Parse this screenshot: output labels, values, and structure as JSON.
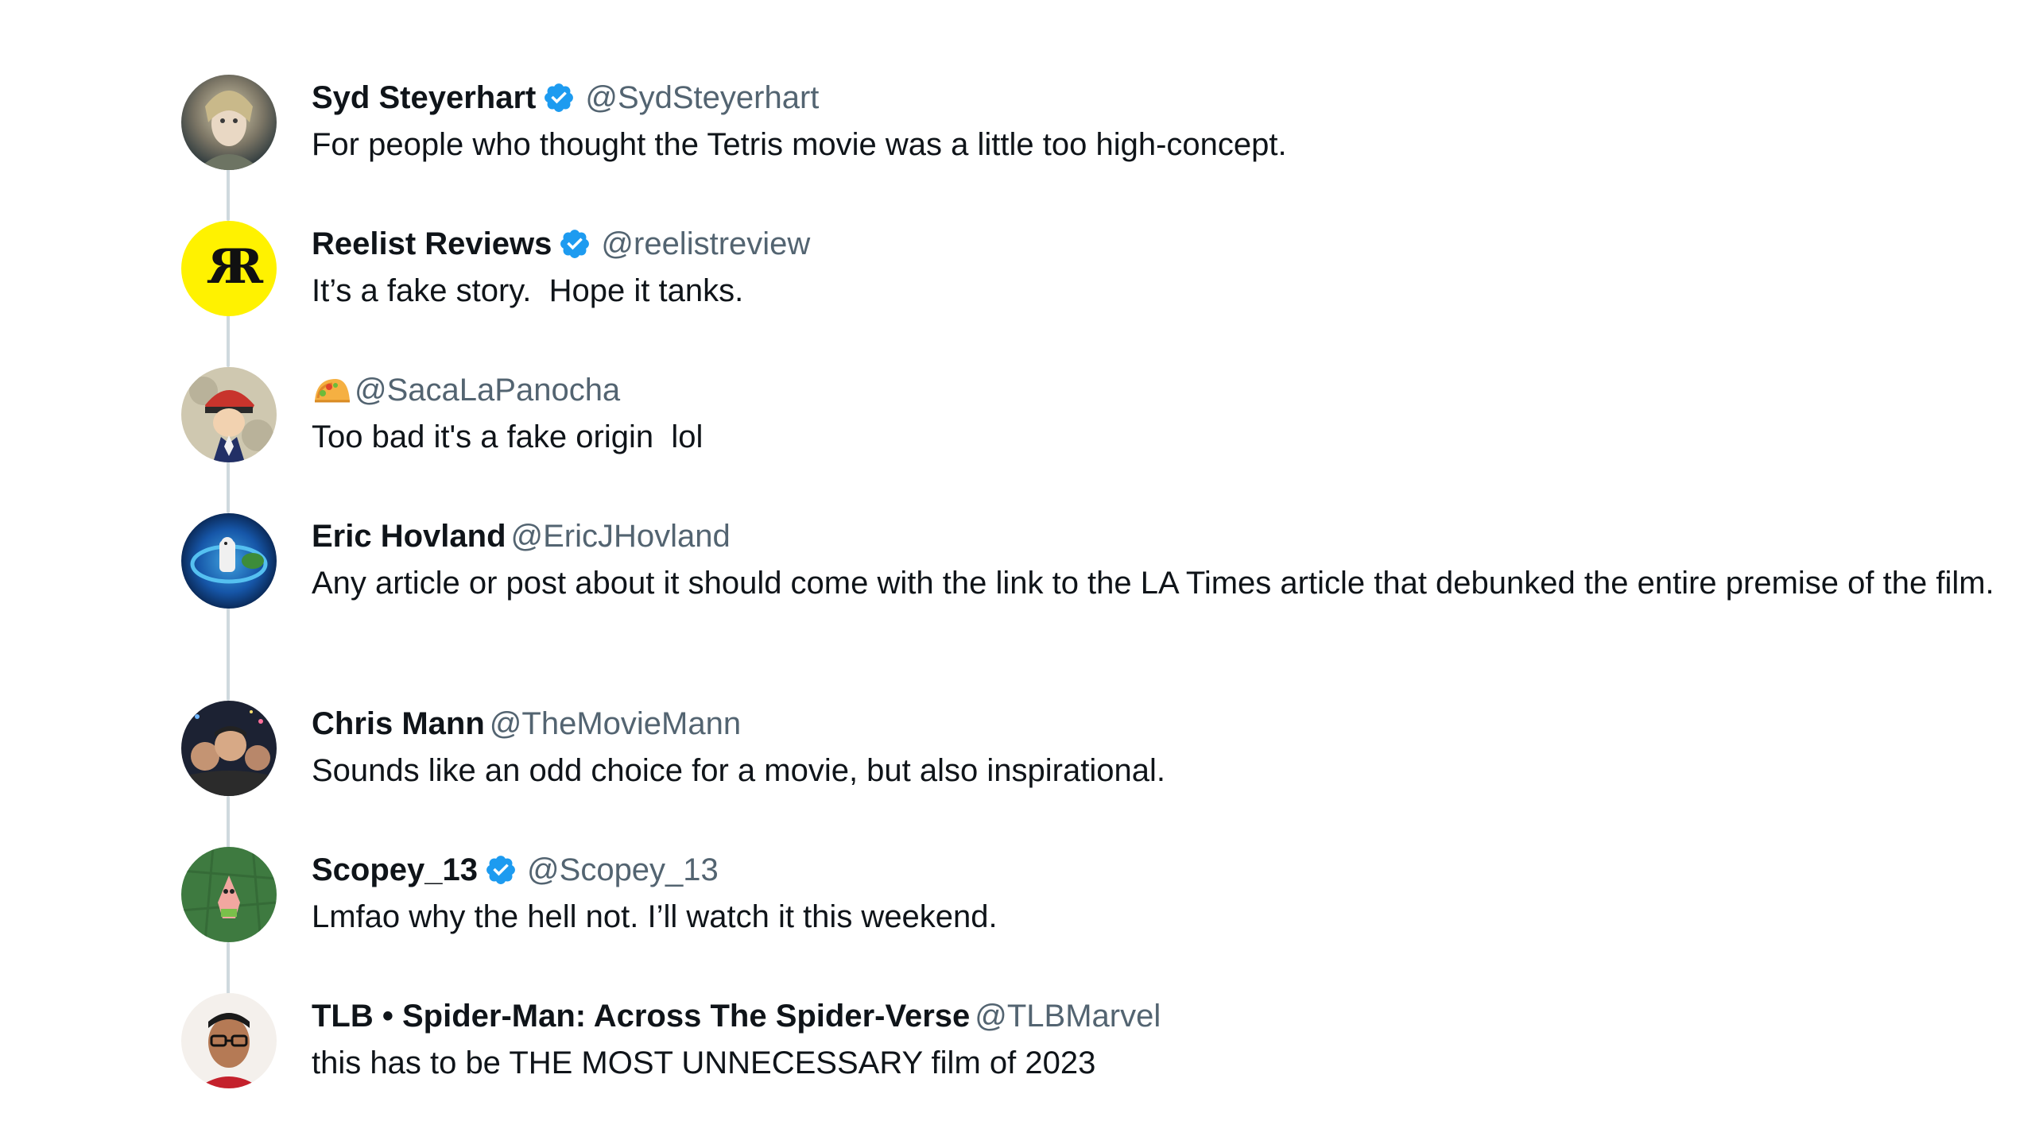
{
  "replies": [
    {
      "name": "Syd Steyerhart",
      "verified": true,
      "handle": "@SydSteyerhart",
      "text": "For people who thought the Tetris movie was a little too high-concept."
    },
    {
      "name": "Reelist Reviews",
      "verified": true,
      "handle": "@reelistreview",
      "text": "It’s a fake story.  Hope it tanks."
    },
    {
      "name": "",
      "name_emoji": "taco-icon",
      "verified": false,
      "handle": "@SacaLaPanocha",
      "text": "Too bad it's a fake origin  lol"
    },
    {
      "name": "Eric Hovland",
      "verified": false,
      "handle": "@EricJHovland",
      "text": "Any article or post about it should come with the link to the LA Times article that debunked the entire premise of the film."
    },
    {
      "name": "Chris Mann",
      "verified": false,
      "handle": "@TheMovieMann",
      "text": "Sounds like an odd choice for a movie, but also inspirational."
    },
    {
      "name": "Scopey_13",
      "verified": true,
      "handle": "@Scopey_13",
      "text": "Lmfao why the hell not. I’ll watch it this weekend."
    },
    {
      "name": "TLB • Spider-Man: Across The Spider-Verse",
      "verified": false,
      "handle": "@TLBMarvel",
      "text": "this has to be THE MOST UNNECESSARY film of 2023"
    }
  ],
  "colors": {
    "text": "#0f1419",
    "secondary": "#536471",
    "verified": "#1d9bf0",
    "connector": "#cfd9de",
    "reelist_bg": "#fff200"
  }
}
